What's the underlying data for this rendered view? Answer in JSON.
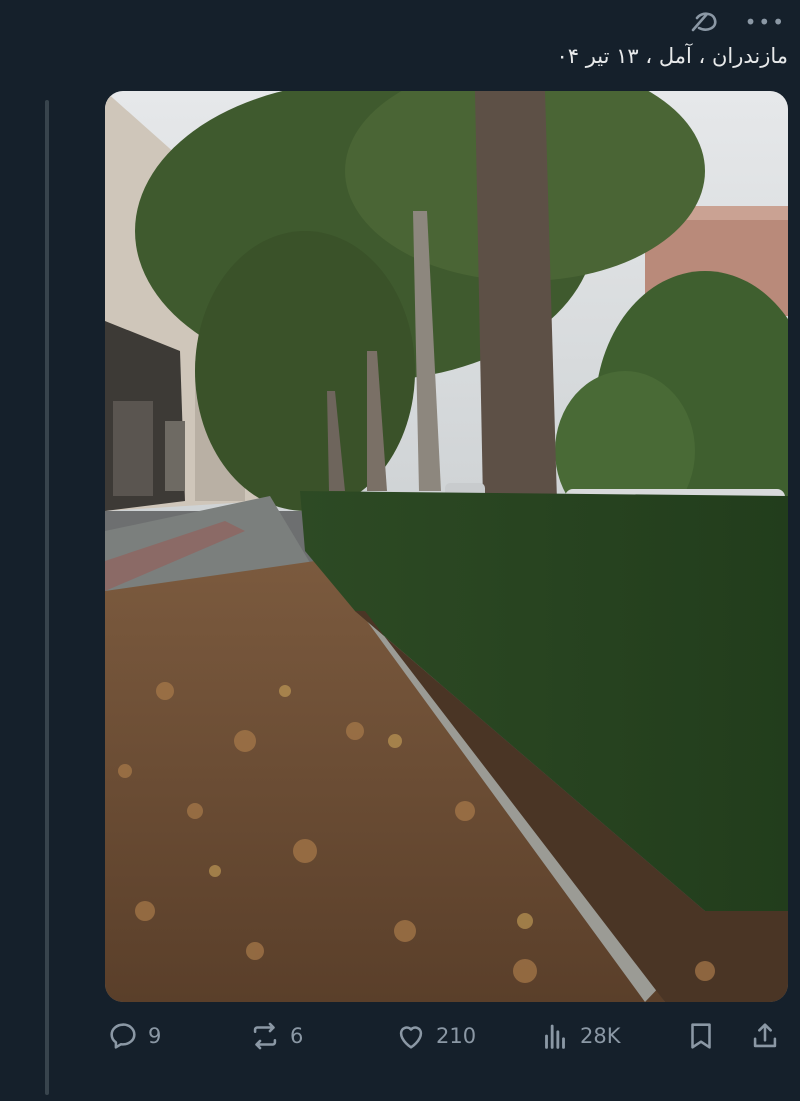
{
  "tweet": {
    "text": "مازندران ، آمل ، ۱۳ تیر ۰۴"
  },
  "header": {
    "grok_icon": "grok-icon",
    "more_icon": "more-horizontal-icon",
    "more_glyph": "•••"
  },
  "stats": {
    "replies": "9",
    "reposts": "6",
    "likes": "210",
    "views": "28K"
  },
  "icons": {
    "reply": "reply-icon",
    "repost": "repost-icon",
    "like": "heart-icon",
    "views": "views-icon",
    "bookmark": "bookmark-icon",
    "share": "share-icon"
  },
  "colors": {
    "background": "#15202b",
    "text": "#e7e9ea",
    "muted": "#8b98a5",
    "thread_line": "#38444d"
  }
}
